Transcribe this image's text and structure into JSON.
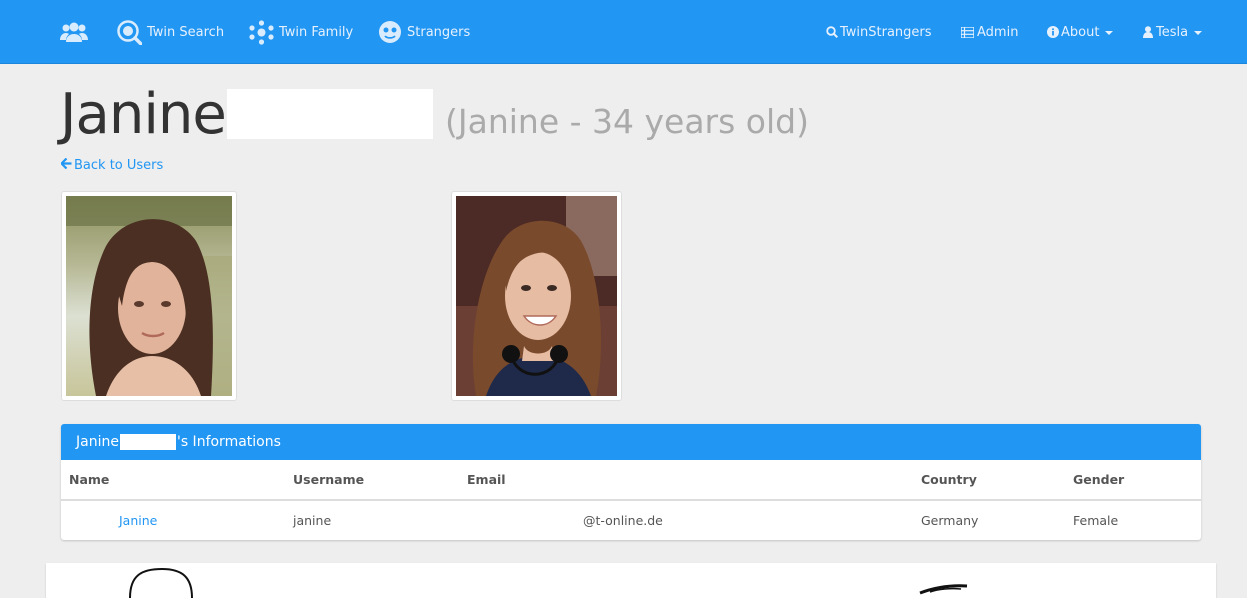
{
  "nav": {
    "left": [
      {
        "label": ""
      },
      {
        "label": "Twin Search"
      },
      {
        "label": "Twin Family"
      },
      {
        "label": "Strangers"
      }
    ],
    "right": [
      {
        "label": "TwinStrangers"
      },
      {
        "label": "Admin"
      },
      {
        "label": "About"
      },
      {
        "label": "Tesla"
      }
    ]
  },
  "header": {
    "first_name": "Janine",
    "subtitle": "(Janine - 34 years old)"
  },
  "back_link": "Back to Users",
  "panel": {
    "title_prefix": "Janine",
    "title_suffix": "'s Informations",
    "columns": [
      "Name",
      "Username",
      "Email",
      "Country",
      "Gender"
    ],
    "row": {
      "name": "Janine",
      "username": "janine",
      "email": "@t-online.de",
      "country": "Germany",
      "gender": "Female"
    }
  },
  "colors": {
    "primary": "#2196f3",
    "background": "#eeeeee"
  }
}
